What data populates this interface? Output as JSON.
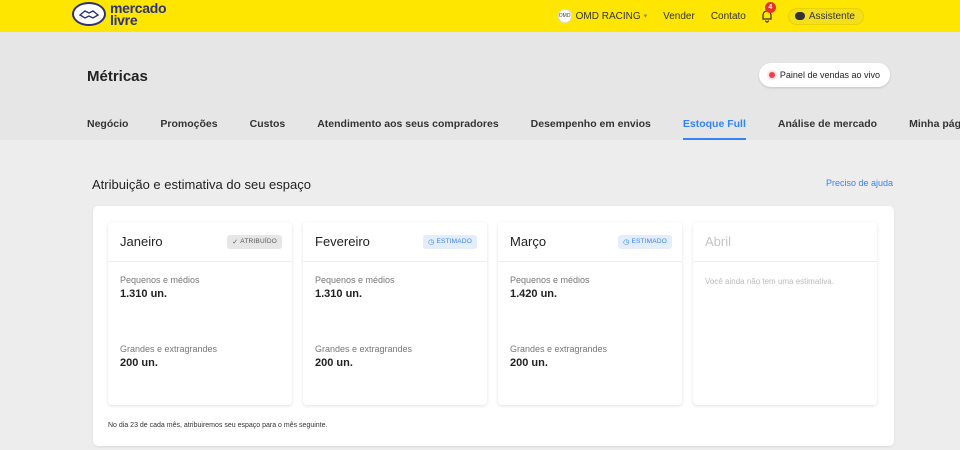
{
  "header": {
    "logo_line1": "mercado",
    "logo_line2": "livre",
    "store_name": "OMD RACING",
    "store_avatar": "OMD",
    "links": [
      "Vender",
      "Contato"
    ],
    "notifications_count": "4",
    "assistant_label": "Assistente"
  },
  "page": {
    "title": "Métricas",
    "live_button": "Painel de vendas ao vivo",
    "tabs": [
      "Negócio",
      "Promoções",
      "Custos",
      "Atendimento aos seus compradores",
      "Desempenho em envios",
      "Estoque Full",
      "Análise de mercado",
      "Minha página"
    ],
    "active_tab": "Estoque Full"
  },
  "section": {
    "title": "Atribuição e estimativa do seu espaço",
    "help_link": "Preciso de ajuda",
    "footnote": "No dia 23 de cada mês, atribuiremos seu espaço para o mês seguinte.",
    "months": [
      {
        "name": "Janeiro",
        "badge": "ATRIBUÍDO",
        "badge_type": "gray",
        "small_label": "Pequenos e médios",
        "small_value": "1.310 un.",
        "large_label": "Grandes e extragrandes",
        "large_value": "200 un."
      },
      {
        "name": "Fevereiro",
        "badge": "ESTIMADO",
        "badge_type": "blue",
        "small_label": "Pequenos e médios",
        "small_value": "1.310 un.",
        "large_label": "Grandes e extragrandes",
        "large_value": "200 un."
      },
      {
        "name": "Março",
        "badge": "ESTIMADO",
        "badge_type": "blue",
        "small_label": "Pequenos e médios",
        "small_value": "1.420 un.",
        "large_label": "Grandes e extragrandes",
        "large_value": "200 un."
      },
      {
        "name": "Abril",
        "empty_message": "Você ainda não tem uma estimativa."
      }
    ]
  },
  "colors": {
    "brand_yellow": "#ffe600",
    "accent_blue": "#3483fa",
    "live_red": "#f23d4f"
  },
  "icons": {
    "logo": "handshake-icon",
    "bell": "bell-icon",
    "assistant": "chat-bubble-icon",
    "attributed": "check-icon",
    "estimated": "clock-icon"
  }
}
